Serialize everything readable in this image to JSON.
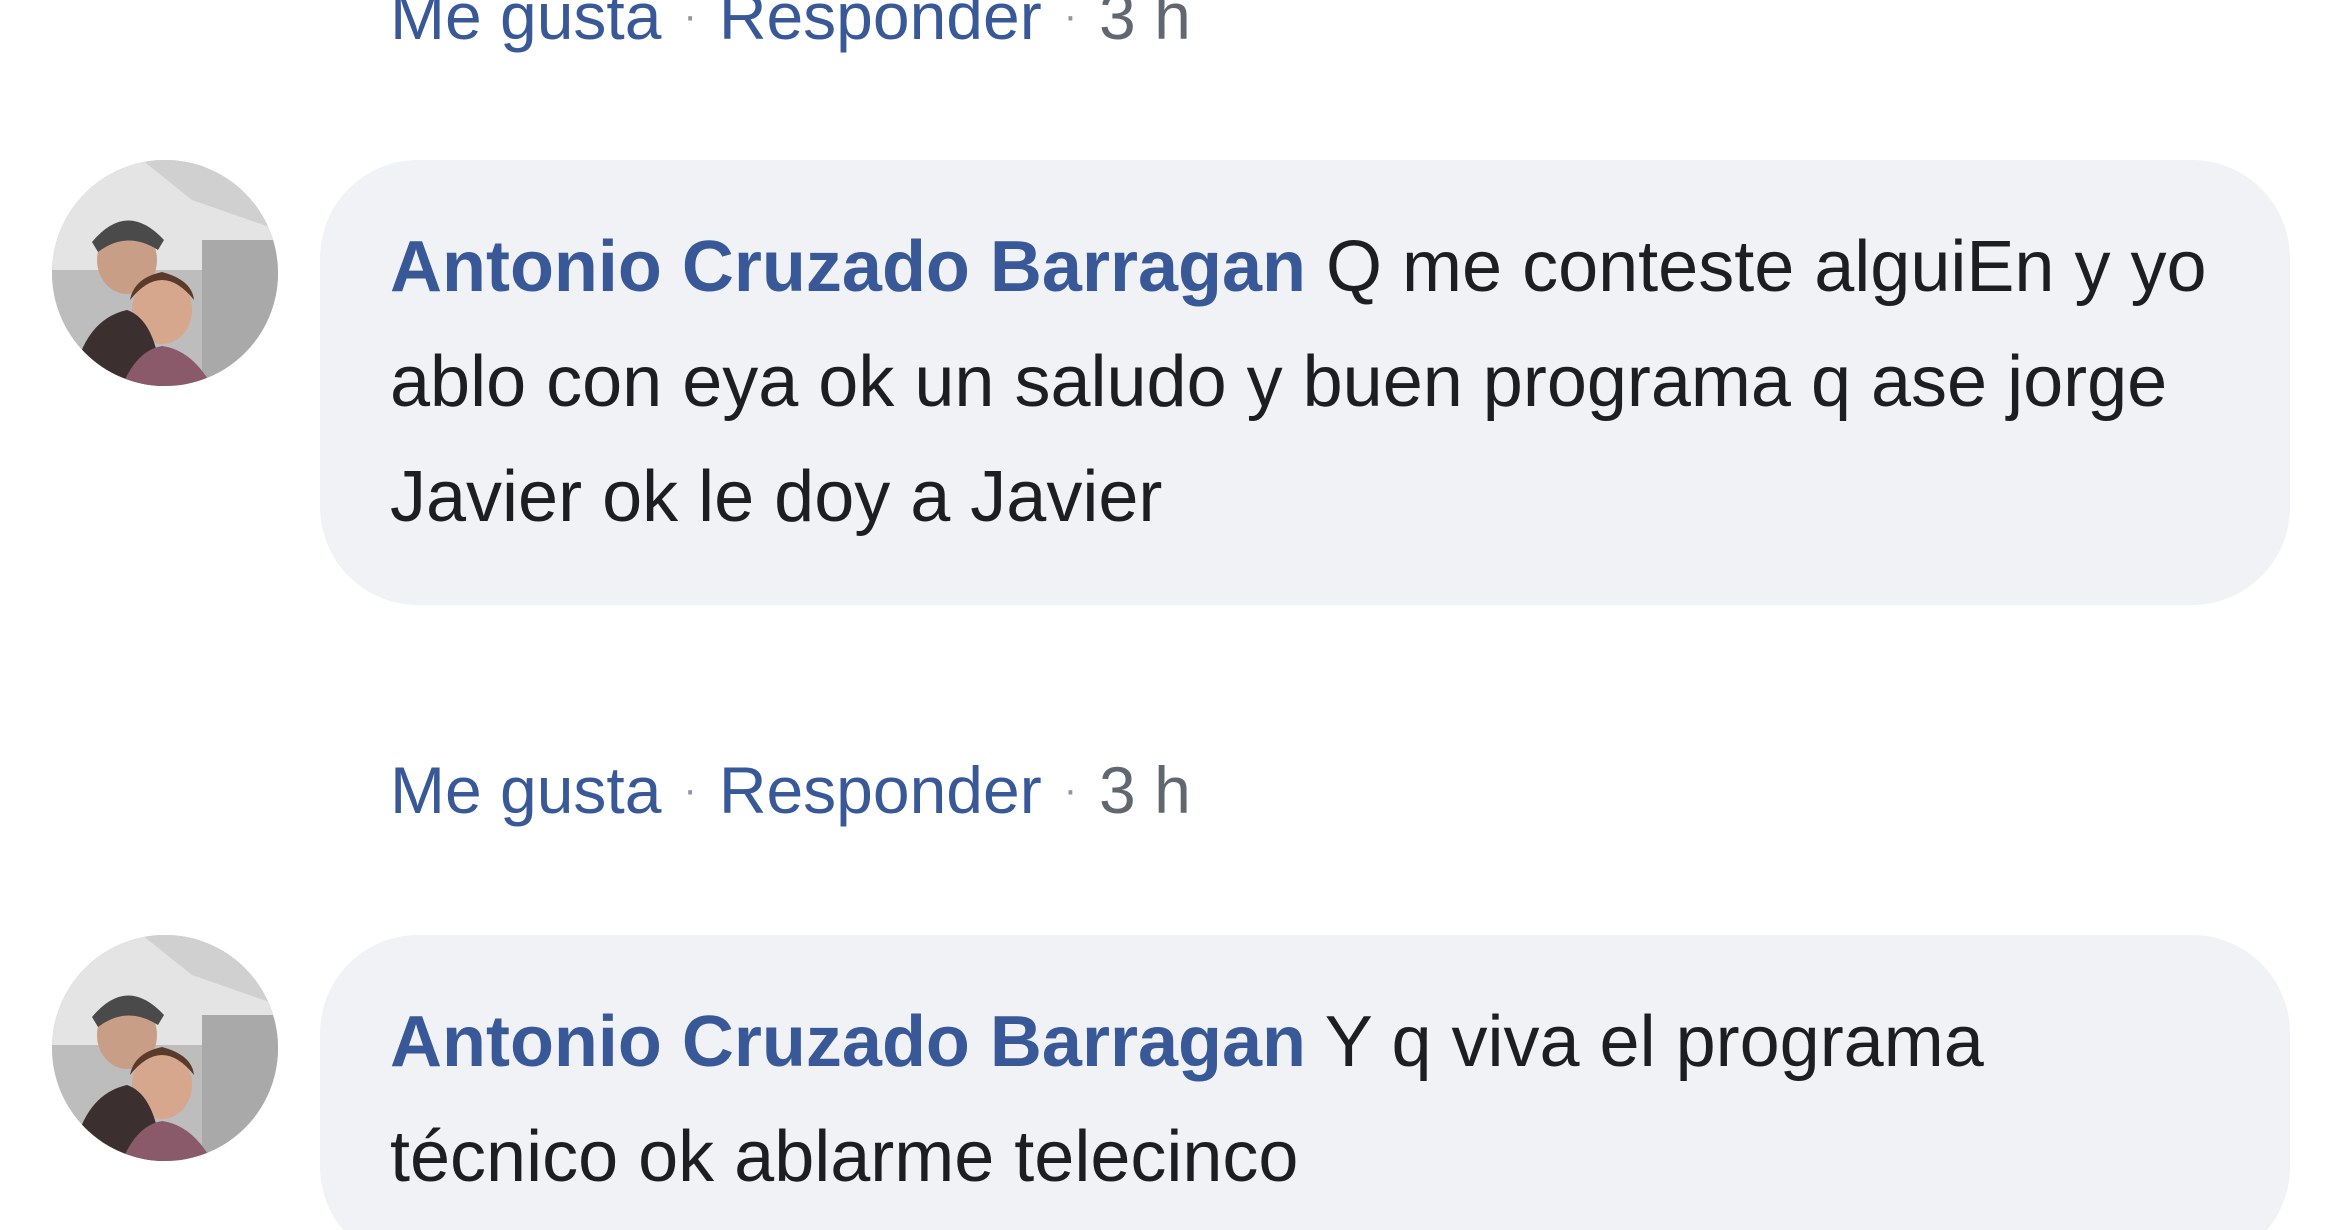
{
  "actions_labels": {
    "like": "Me gusta",
    "reply": "Responder",
    "separator": "·"
  },
  "comments": [
    {
      "author": "Antonio Cruzado Barragan",
      "text": "Q me conteste alguiEn y yo ablo con eya ok un saludo y buen programa q ase jorge Javier ok le doy a Javier",
      "time": "3 h",
      "avatar": "user-photo"
    },
    {
      "author": "Antonio Cruzado Barragan",
      "text": "Y q viva el programa técnico ok ablarme telecinco",
      "avatar": "user-photo"
    }
  ],
  "previous_comment": {
    "time": "3 h"
  },
  "colors": {
    "link": "#385898",
    "bubble": "#f0f2f5",
    "text": "#1c1e21",
    "meta": "#606770"
  }
}
